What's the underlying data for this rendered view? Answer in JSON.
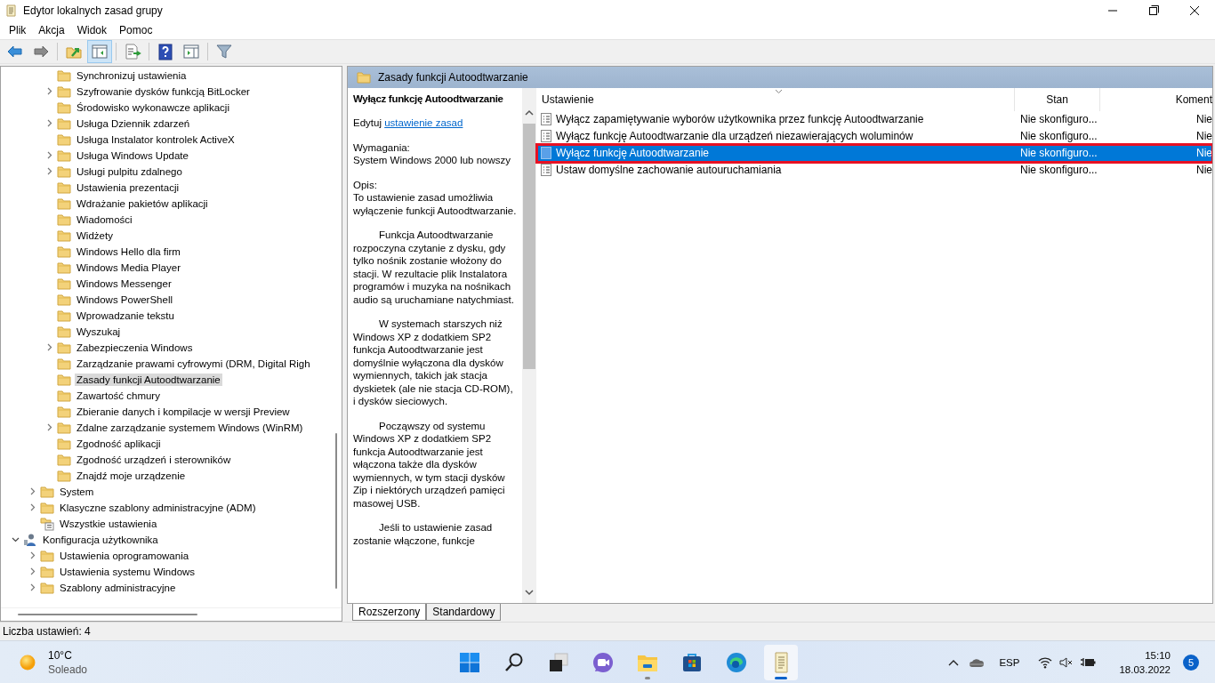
{
  "window": {
    "title": "Edytor lokalnych zasad grupy"
  },
  "menu": [
    "Plik",
    "Akcja",
    "Widok",
    "Pomoc"
  ],
  "toolbar": [
    [
      {
        "kind": "back",
        "selected": false
      },
      {
        "kind": "forward",
        "selected": false
      }
    ],
    [
      {
        "kind": "up",
        "selected": false
      },
      {
        "kind": "tree",
        "selected": true
      }
    ],
    [
      {
        "kind": "export",
        "selected": false
      }
    ],
    [
      {
        "kind": "help",
        "selected": false
      },
      {
        "kind": "actions",
        "selected": false
      }
    ],
    [
      {
        "kind": "filter",
        "selected": false
      }
    ]
  ],
  "tree": [
    {
      "children": [
        {
          "children": [
            {
              "label": "Synchronizuj ustawienia",
              "kind": "folder",
              "expandable": false,
              "selected": false
            },
            {
              "label": "Szyfrowanie dysków funkcją BitLocker",
              "kind": "folder",
              "expandable": true,
              "expanded": false,
              "selected": false
            },
            {
              "label": "Środowisko wykonawcze aplikacji",
              "kind": "folder",
              "expandable": false,
              "selected": false
            },
            {
              "label": "Usługa Dziennik zdarzeń",
              "kind": "folder",
              "expandable": true,
              "expanded": false,
              "selected": false
            },
            {
              "label": "Usługa Instalator kontrolek ActiveX",
              "kind": "folder",
              "expandable": false,
              "selected": false
            },
            {
              "label": "Usługa Windows Update",
              "kind": "folder",
              "expandable": true,
              "expanded": false,
              "selected": false
            },
            {
              "label": "Usługi pulpitu zdalnego",
              "kind": "folder",
              "expandable": true,
              "expanded": false,
              "selected": false
            },
            {
              "label": "Ustawienia prezentacji",
              "kind": "folder",
              "expandable": false,
              "selected": false
            },
            {
              "label": "Wdrażanie pakietów aplikacji",
              "kind": "folder",
              "expandable": false,
              "selected": false
            },
            {
              "label": "Wiadomości",
              "kind": "folder",
              "expandable": false,
              "selected": false
            },
            {
              "label": "Widżety",
              "kind": "folder",
              "expandable": false,
              "selected": false
            },
            {
              "label": "Windows Hello dla firm",
              "kind": "folder",
              "expandable": false,
              "selected": false
            },
            {
              "label": "Windows Media Player",
              "kind": "folder",
              "expandable": false,
              "selected": false
            },
            {
              "label": "Windows Messenger",
              "kind": "folder",
              "expandable": false,
              "selected": false
            },
            {
              "label": "Windows PowerShell",
              "kind": "folder",
              "expandable": false,
              "selected": false
            },
            {
              "label": "Wprowadzanie tekstu",
              "kind": "folder",
              "expandable": false,
              "selected": false
            },
            {
              "label": "Wyszukaj",
              "kind": "folder",
              "expandable": false,
              "selected": false
            },
            {
              "label": "Zabezpieczenia Windows",
              "kind": "folder",
              "expandable": true,
              "expanded": false,
              "selected": false
            },
            {
              "label": "Zarządzanie prawami cyfrowymi (DRM, Digital Righ",
              "kind": "folder",
              "expandable": false,
              "selected": false
            },
            {
              "label": "Zasady funkcji Autoodtwarzanie",
              "kind": "folder",
              "expandable": false,
              "selected": true
            },
            {
              "label": "Zawartość chmury",
              "kind": "folder",
              "expandable": false,
              "selected": false
            },
            {
              "label": "Zbieranie danych i kompilacje w wersji Preview",
              "kind": "folder",
              "expandable": false,
              "selected": false
            },
            {
              "label": "Zdalne zarządzanie systemem Windows (WinRM)",
              "kind": "folder",
              "expandable": true,
              "expanded": false,
              "selected": false
            },
            {
              "label": "Zgodność aplikacji",
              "kind": "folder",
              "expandable": false,
              "selected": false
            },
            {
              "label": "Zgodność urządzeń i sterowników",
              "kind": "folder",
              "expandable": false,
              "selected": false
            },
            {
              "label": "Znajdź moje urządzenie",
              "kind": "folder",
              "expandable": false,
              "selected": false
            }
          ]
        },
        {
          "label": "System",
          "kind": "folder",
          "expandable": true,
          "expanded": false,
          "selected": false
        },
        {
          "label": "Klasyczne szablony administracyjne (ADM)",
          "kind": "folder",
          "expandable": true,
          "expanded": false,
          "selected": false
        },
        {
          "label": "Wszystkie ustawienia",
          "kind": "settings",
          "expandable": false,
          "selected": false
        }
      ]
    },
    {
      "label": "Konfiguracja użytkownika",
      "kind": "user",
      "expandable": true,
      "expanded": true,
      "selected": false,
      "children": [
        {
          "label": "Ustawienia oprogramowania",
          "kind": "folder",
          "expandable": true,
          "expanded": false,
          "selected": false
        },
        {
          "label": "Ustawienia systemu Windows",
          "kind": "folder",
          "expandable": true,
          "expanded": false,
          "selected": false
        },
        {
          "label": "Szablony administracyjne",
          "kind": "folder",
          "expandable": true,
          "expanded": false,
          "selected": false
        }
      ]
    }
  ],
  "panel": {
    "title": "Zasady funkcji Autoodtwarzanie"
  },
  "description": {
    "title": "Wyłącz funkcję Autoodtwarzanie",
    "edit_prefix": "Edytuj",
    "edit_link": "ustawienie zasad",
    "requirements_label": "Wymagania:",
    "requirements": "System Windows 2000 lub nowszy",
    "description_label": "Opis:",
    "paragraphs": [
      {
        "text": "To ustawienie zasad umożliwia wyłączenie funkcji Autoodtwarzanie.",
        "indent": false
      },
      {
        "text": "Funkcja Autoodtwarzanie rozpoczyna czytanie z dysku, gdy tylko nośnik zostanie włożony do stacji. W rezultacie plik Instalatora programów i muzyka na nośnikach audio są uruchamiane natychmiast.",
        "indent": true
      },
      {
        "text": "W systemach starszych niż Windows XP z dodatkiem SP2 funkcja Autoodtwarzanie jest domyślnie wyłączona dla dysków wymiennych, takich jak stacja dyskietek (ale nie stacja CD-ROM), i dysków sieciowych.",
        "indent": true
      },
      {
        "text": "Począwszy od systemu Windows XP z dodatkiem SP2 funkcja Autoodtwarzanie jest włączona także dla dysków wymiennych, w tym stacji dysków Zip i niektórych urządzeń pamięci masowej USB.",
        "indent": true
      },
      {
        "text": "Jeśli to ustawienie zasad zostanie włączone, funkcje",
        "indent": true
      }
    ]
  },
  "table": {
    "columns": [
      "Ustawienie",
      "Stan",
      "Koment"
    ],
    "rows": [
      {
        "cells": [
          "Wyłącz zapamiętywanie wyborów użytkownika przez funkcję Autoodtwarzanie",
          "Nie skonfiguro...",
          "Nie"
        ],
        "selected": false,
        "annotated": false
      },
      {
        "cells": [
          "Wyłącz funkcję Autoodtwarzanie dla urządzeń niezawierających woluminów",
          "Nie skonfiguro...",
          "Nie"
        ],
        "selected": false,
        "annotated": false
      },
      {
        "cells": [
          "Wyłącz funkcję Autoodtwarzanie",
          "Nie skonfiguro...",
          "Nie"
        ],
        "selected": true,
        "annotated": true
      },
      {
        "cells": [
          "Ustaw domyślne zachowanie autouruchamiania",
          "Nie skonfiguro...",
          "Nie"
        ],
        "selected": false,
        "annotated": false
      }
    ]
  },
  "view_tabs": [
    {
      "label": "Rozszerzony",
      "selected": true
    },
    {
      "label": "Standardowy",
      "selected": false
    }
  ],
  "status_bar": "Liczba ustawień: 4",
  "taskbar": {
    "weather": {
      "temperature": "10°C",
      "condition": "Soleado"
    },
    "apps": [
      {
        "kind": "start",
        "running": false,
        "active": false
      },
      {
        "kind": "search",
        "running": false,
        "active": false
      },
      {
        "kind": "taskview",
        "running": false,
        "active": false
      },
      {
        "kind": "chat",
        "running": false,
        "active": false
      },
      {
        "kind": "explorer",
        "running": true,
        "active": false
      },
      {
        "kind": "store",
        "running": false,
        "active": false
      },
      {
        "kind": "browser",
        "running": false,
        "active": false
      },
      {
        "kind": "scroll",
        "running": true,
        "active": true
      }
    ],
    "tray": {
      "language": "ESP",
      "time": "15:10",
      "date": "18.03.2022",
      "notifications": "5"
    }
  }
}
